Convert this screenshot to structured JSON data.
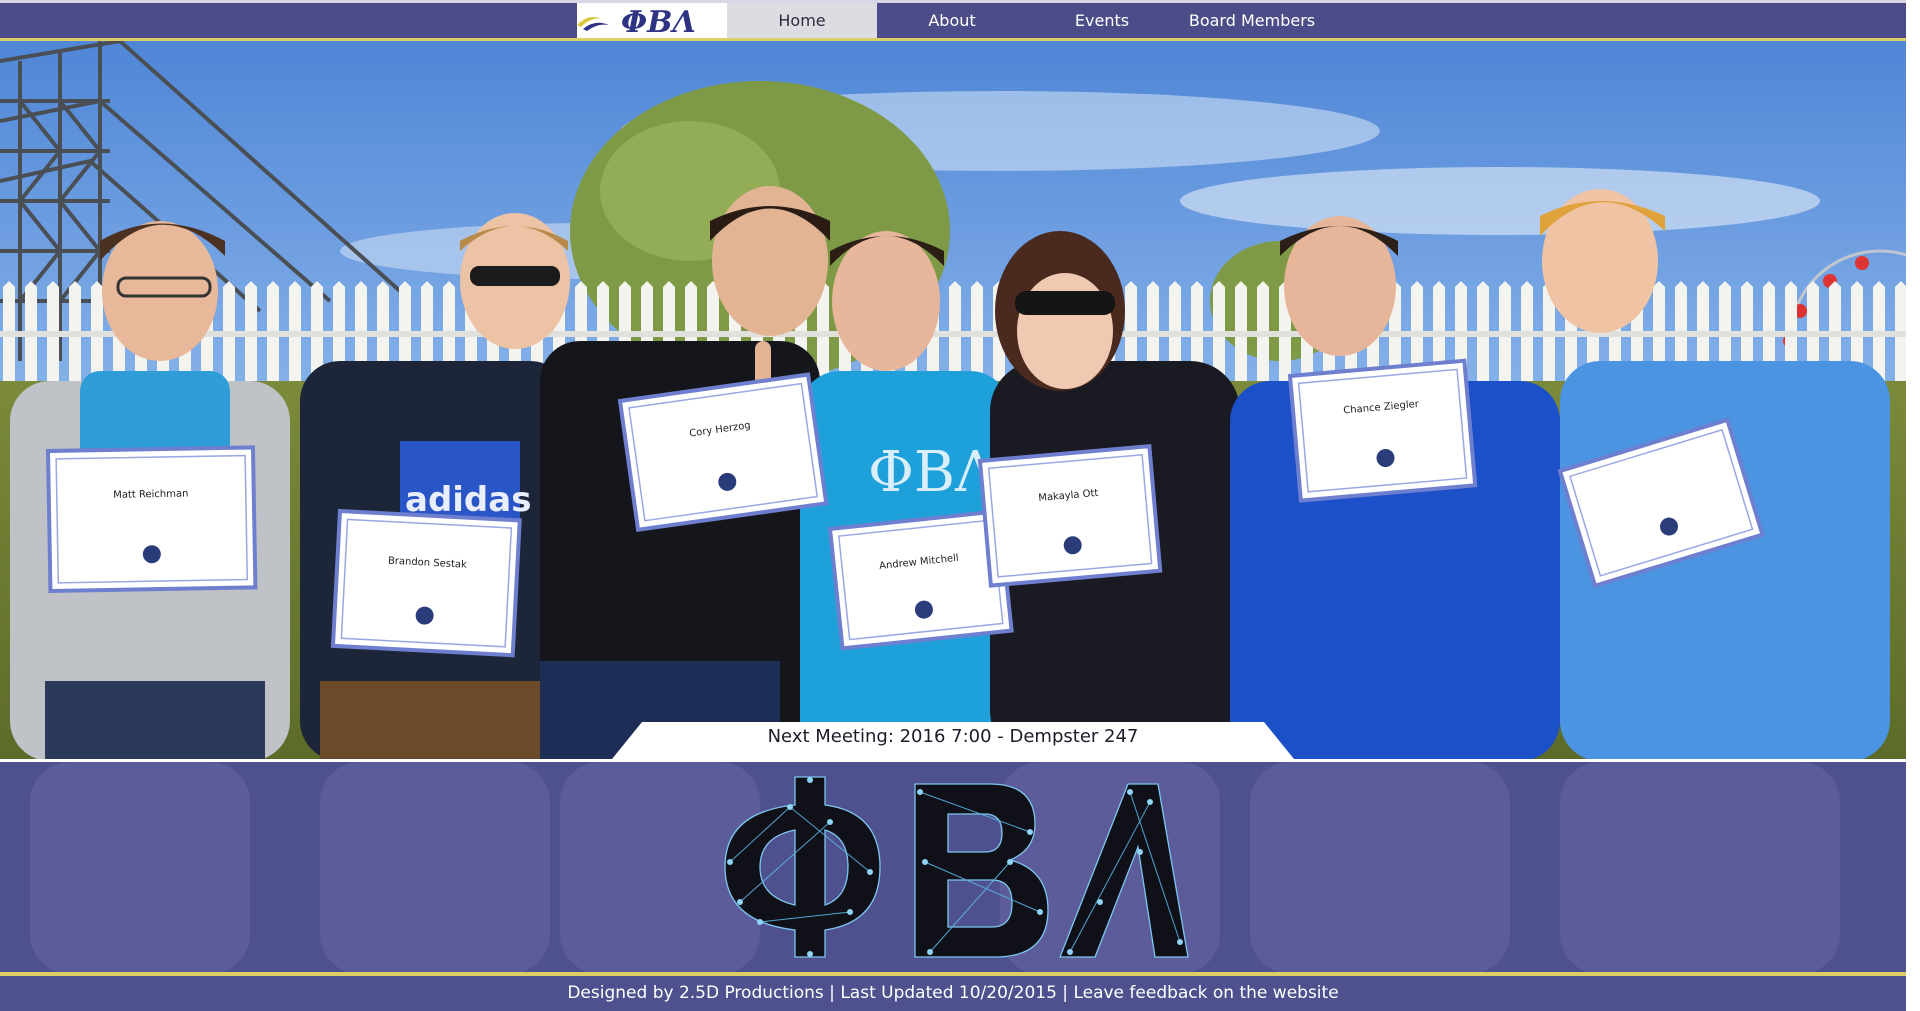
{
  "nav": {
    "logo": "ΦΒΛ",
    "items": [
      {
        "label": "Home",
        "active": true
      },
      {
        "label": "About",
        "active": false
      },
      {
        "label": "Events",
        "active": false
      },
      {
        "label": "Board Members",
        "active": false
      }
    ]
  },
  "hero": {
    "certificates": [
      "Matt Reichman",
      "Brandon Sestak",
      "Cory Herzog",
      "Andrew Mitchell",
      "Makayla Ott",
      "Chance Ziegler"
    ],
    "shirt_text": [
      "ΦΒΛ",
      "adidas"
    ]
  },
  "meeting": {
    "text": "Next Meeting: 2016 7:00 - Dempster 247"
  },
  "logo_band": {
    "logo_text": "ΦΒΛ"
  },
  "footer": {
    "designed_by": "Designed by 2.5D Productions",
    "sep1": " | ",
    "last_updated": "Last Updated 10/20/2015",
    "sep2": " | ",
    "feedback": "Leave feedback on the website"
  },
  "colors": {
    "nav_bg": "#4c4d88",
    "accent_gold": "#dccf66",
    "band_bg": "#4f508e",
    "active_tab": "#dcdce3"
  }
}
